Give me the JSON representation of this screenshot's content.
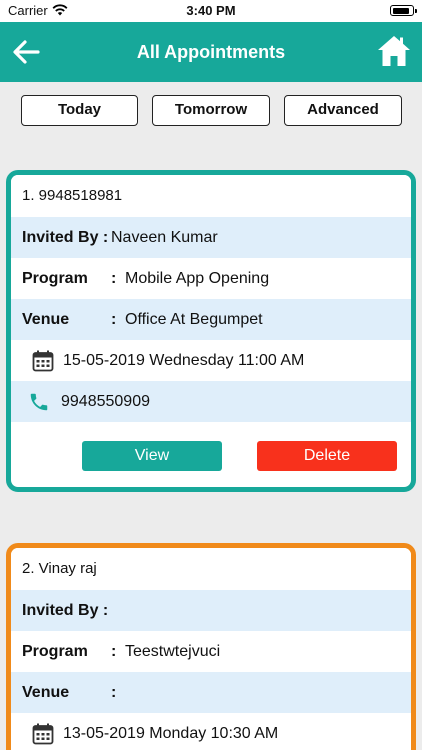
{
  "status_bar": {
    "carrier": "Carrier",
    "time": "3:40 PM",
    "battery_level": 0.75
  },
  "header": {
    "title": "All Appointments",
    "accent_color": "#17a89a"
  },
  "filters": {
    "today": "Today",
    "tomorrow": "Tomorrow",
    "advanced": "Advanced"
  },
  "labels": {
    "invited_by": "Invited By :",
    "program": "Program",
    "venue": "Venue",
    "colon": ":",
    "view": "View",
    "delete": "Delete"
  },
  "appointments": [
    {
      "title": "1. 9948518981",
      "invited_by": "Naveen Kumar",
      "program": "Mobile App Opening",
      "venue": "Office At Begumpet",
      "datetime": "15-05-2019 Wednesday 11:00 AM",
      "phone": "9948550909",
      "border_color": "#17a89a"
    },
    {
      "title": "2. Vinay raj",
      "invited_by": "",
      "program": "Teestwtejvuci",
      "venue": "",
      "datetime": "13-05-2019 Monday 10:30 AM",
      "border_color": "#f08a1a"
    }
  ],
  "colors": {
    "teal": "#17a89a",
    "orange": "#f08a1a",
    "delete_red": "#f8311c",
    "row_highlight": "#dfeefa"
  },
  "icons": [
    "back-arrow-icon",
    "home-icon",
    "calendar-icon",
    "phone-icon",
    "wifi-icon",
    "battery-icon"
  ]
}
